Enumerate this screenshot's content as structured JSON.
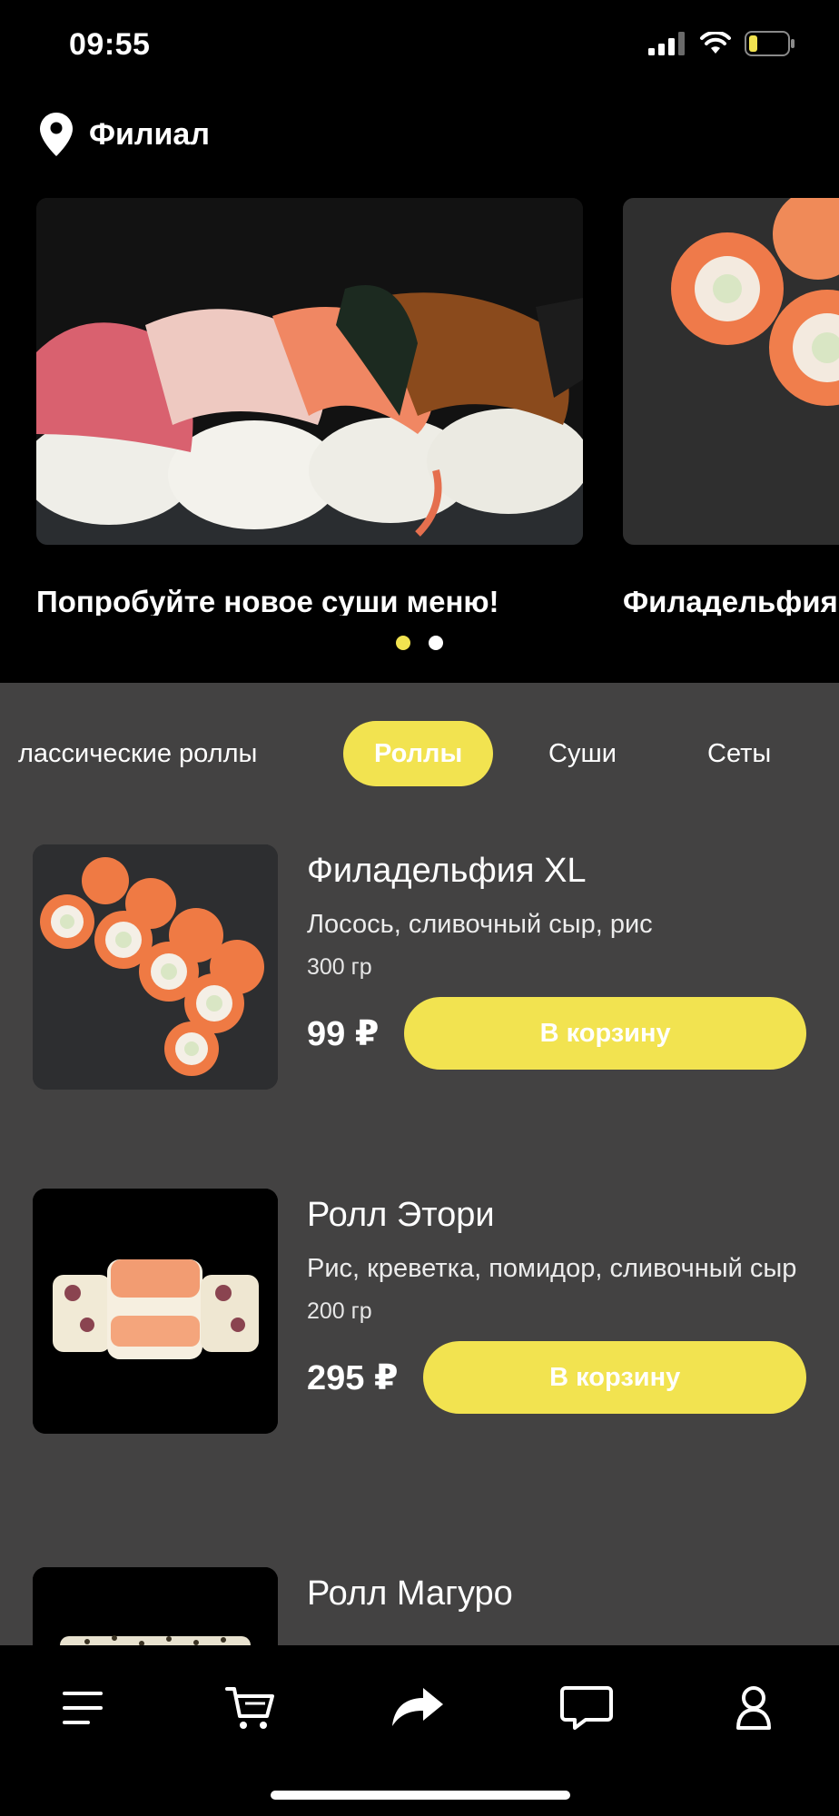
{
  "status_bar": {
    "time": "09:55"
  },
  "branch": {
    "label": "Филиал"
  },
  "banners": [
    {
      "caption": "Попробуйте новое суши меню!"
    },
    {
      "caption": "Филадельфия"
    }
  ],
  "carousel": {
    "pages": 2,
    "active": 0
  },
  "tabs": [
    {
      "label": "лассические роллы"
    },
    {
      "label": "Роллы"
    },
    {
      "label": "Суши"
    },
    {
      "label": "Сеты"
    }
  ],
  "products": [
    {
      "name": "Филадельфия XL",
      "desc": "Лосось, сливочный сыр, рис",
      "weight": "300 гр",
      "price": "99 ₽",
      "button": "В корзину"
    },
    {
      "name": "Ролл Этори",
      "desc": "Рис, креветка, помидор, сливочный сыр",
      "weight": "200 гр",
      "price": "295 ₽",
      "button": "В корзину"
    },
    {
      "name": "Ролл Магуро",
      "desc": "",
      "weight": "",
      "price": "",
      "button": ""
    }
  ],
  "bottom_nav": {
    "items": [
      {
        "icon": "menu-icon"
      },
      {
        "icon": "cart-icon"
      },
      {
        "icon": "share-icon"
      },
      {
        "icon": "chat-icon"
      },
      {
        "icon": "profile-icon"
      }
    ]
  },
  "colors": {
    "accent": "#f2e350",
    "background": "#000000",
    "content_bg": "#434242"
  }
}
